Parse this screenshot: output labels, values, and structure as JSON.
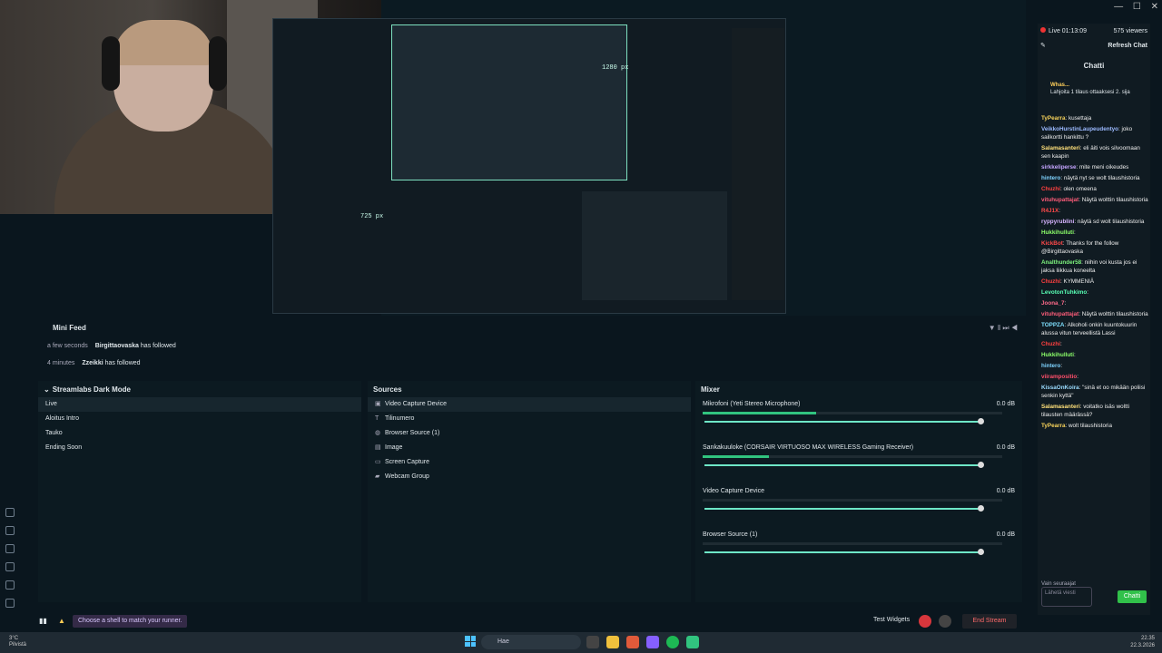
{
  "chat": {
    "live_time": "Live 01:13:09",
    "viewers": "575 viewers",
    "refresh": "Refresh Chat",
    "title": "Chatti",
    "gift_banner_user": "Whas...",
    "gift_banner_text": "Lahjoita 1 tilaus ottaaksesi 2. sija",
    "messages": [
      {
        "user": "TyPearra",
        "text": "kusettaja",
        "color": "#f8d35b"
      },
      {
        "user": "VeikkoHurstinLaupeudentyo",
        "text": "joko sailkortti hankittu ?",
        "color": "#9bb9ff"
      },
      {
        "user": "Salamasanteri",
        "text": "eli äiti vois silvoomaan sen kaapin",
        "color": "#ffe07a"
      },
      {
        "user": "sirkkeliperse",
        "text": "mite meni oikeudes",
        "color": "#c5a5ff"
      },
      {
        "user": "hintero",
        "text": "näytä nyt se wolt tilaushistoria",
        "color": "#7fd4ff"
      },
      {
        "user": "Chuzhi",
        "text": "olen omeena",
        "color": "#ff4040"
      },
      {
        "user": "vituhupattajat",
        "text": "Näytä wolttin tilaushistoria",
        "color": "#ff5d7a"
      },
      {
        "user": "R4J1X",
        "text": "",
        "color": "#ff4a4a"
      },
      {
        "user": "ryppyrublini",
        "text": "näytä sd wolt tilaushistoria",
        "color": "#d7b4ff"
      },
      {
        "user": "Hukkihulluti",
        "text": "",
        "color": "#8cff6a"
      },
      {
        "user": "KickBot",
        "text": "Thanks for the follow @Birgittaovaska",
        "color": "#ff4a4a"
      },
      {
        "user": "Analthunder58",
        "text": "niihin voi kusta jos ei jaksa liikkua koneelta",
        "color": "#7df27d"
      },
      {
        "user": "Chuzhi",
        "text": "KYMMENIÄ",
        "color": "#ff4040"
      },
      {
        "user": "LevotonTuhkimo",
        "text": "",
        "color": "#58ffb5"
      },
      {
        "user": "Joona_7",
        "text": "",
        "color": "#ff6a8a"
      },
      {
        "user": "vituhupattajat",
        "text": "Näytä wolttin tilaushistoria",
        "color": "#ff5d7a"
      },
      {
        "user": "TOPPZA",
        "text": "Alkoholi onkin kuuntokuurin alussa vitun terveellistä Lassi",
        "color": "#7fe0ff"
      },
      {
        "user": "Chuzhi",
        "text": "",
        "color": "#ff4040"
      },
      {
        "user": "Hukkihulluti",
        "text": "",
        "color": "#8cff6a"
      },
      {
        "user": "hintero",
        "text": "",
        "color": "#7fd4ff"
      },
      {
        "user": "viirampositio",
        "text": "",
        "color": "#ff4f6b"
      },
      {
        "user": "KissaOnKoira",
        "text": "\"sinä et oo mikään poliisi senkin kyttä\"",
        "color": "#9bdcff"
      },
      {
        "user": "Salamasanteri",
        "text": "voitatko isäs woltti tilausten määrässä?",
        "color": "#ffe07a"
      },
      {
        "user": "TyPearra",
        "text": "wolt tilaushistoria",
        "color": "#f8d35b"
      }
    ],
    "followers_only": "Vain seuraajat",
    "input_placeholder": "Lähetä viesti",
    "send_label": "Chatti"
  },
  "preview": {
    "width_label": "1280 px",
    "height_label": "725 px"
  },
  "minifeed": {
    "title": "Mini Feed",
    "rows": [
      {
        "time": "a few seconds",
        "user": "Birgittaovaska",
        "action": "has followed"
      },
      {
        "time": "4 minutes",
        "user": "Zzeikki",
        "action": "has followed"
      }
    ]
  },
  "scenes": {
    "title": "Streamlabs Dark Mode",
    "items": [
      "Live",
      "Aloitus Intro",
      "Tauko",
      "Ending Soon"
    ]
  },
  "sources": {
    "title": "Sources",
    "items": [
      {
        "label": "Video Capture Device",
        "icon": "▣"
      },
      {
        "label": "Tilinumero",
        "icon": "T"
      },
      {
        "label": "Browser Source (1)",
        "icon": "◍"
      },
      {
        "label": "Image",
        "icon": "▤"
      },
      {
        "label": "Screen Capture",
        "icon": "▭"
      },
      {
        "label": "Webcam Group",
        "icon": "▰"
      }
    ]
  },
  "mixer": {
    "title": "Mixer",
    "channels": [
      {
        "name": "Mikrofoni (Yeti Stereo Microphone)",
        "db": "0.0 dB",
        "level": 0.38
      },
      {
        "name": "Sankakuuloke (CORSAIR VIRTUOSO MAX WIRELESS Gaming Receiver)",
        "db": "0.0 dB",
        "level": 0.22
      },
      {
        "name": "Video Capture Device",
        "db": "0.0 dB",
        "level": 0
      },
      {
        "name": "Browser Source (1)",
        "db": "0.0 dB",
        "level": 0
      }
    ]
  },
  "statusbar": {
    "shell_chip": "Choose a shell to match your runner.",
    "test_widgets": "Test Widgets",
    "end_stream": "End Stream"
  },
  "taskbar": {
    "weather_temp": "3°C",
    "weather_desc": "Pilvistä",
    "search": "Hae",
    "time": "22.35",
    "date": "22.3.2026"
  }
}
